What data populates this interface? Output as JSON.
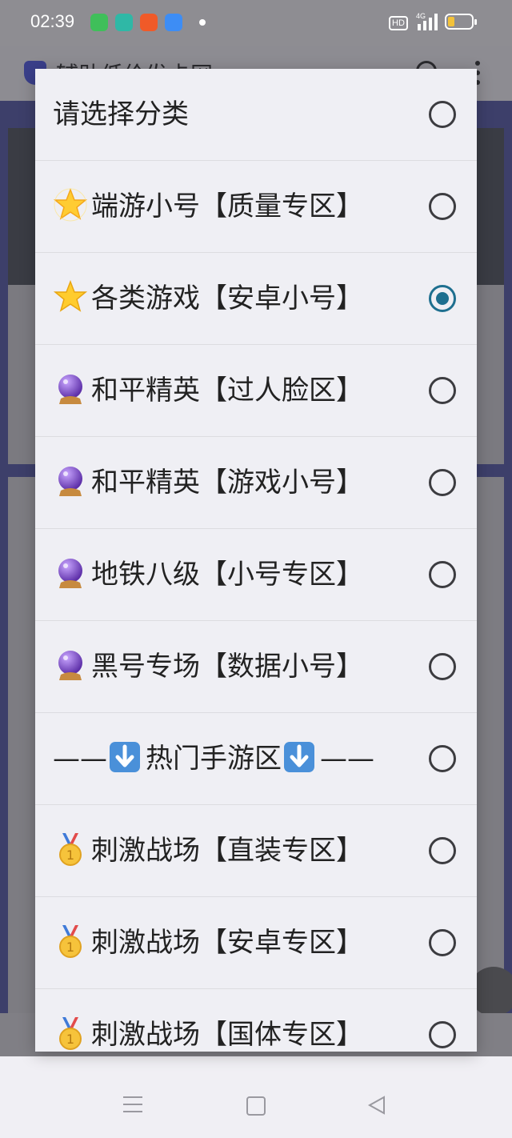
{
  "status_bar": {
    "time": "02:39",
    "hd_label": "HD",
    "network": "4G",
    "app_icons": [
      "wechat-icon",
      "chat-bubble-icon",
      "app-grid-icon",
      "browser-icon"
    ],
    "battery_color": "#f3c23a"
  },
  "background_page": {
    "site_title": "辅助低价发卡网"
  },
  "dialog": {
    "options": [
      {
        "text": "请选择分类",
        "icon": "",
        "selected": false
      },
      {
        "text": "端游小号【质量专区】",
        "icon": "glowing-star-icon",
        "selected": false
      },
      {
        "text": "各类游戏【安卓小号】",
        "icon": "star-icon",
        "selected": true
      },
      {
        "text": "和平精英【过人脸区】",
        "icon": "crystal-ball-icon",
        "selected": false
      },
      {
        "text": "和平精英【游戏小号】",
        "icon": "crystal-ball-icon",
        "selected": false
      },
      {
        "text": "地铁八级【小号专区】",
        "icon": "crystal-ball-icon",
        "selected": false
      },
      {
        "text": "黑号专场【数据小号】",
        "icon": "crystal-ball-icon",
        "selected": false
      },
      {
        "text": "热门手游区",
        "icon": "down-arrow-icon",
        "prefix": "——",
        "suffix": "——",
        "selected": false
      },
      {
        "text": "刺激战场【直装专区】",
        "icon": "medal-icon",
        "selected": false
      },
      {
        "text": "刺激战场【安卓专区】",
        "icon": "medal-icon",
        "selected": false
      },
      {
        "text": "刺激战场【国体专区】",
        "icon": "medal-icon",
        "selected": false
      }
    ],
    "accent_color": "#1e6f8f"
  }
}
